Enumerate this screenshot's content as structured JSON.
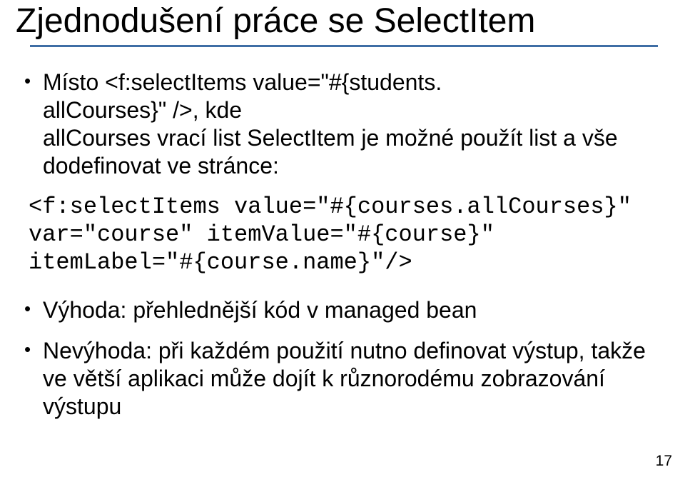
{
  "title": "Zjednodušení práce se SelectItem",
  "bullets": {
    "b1_a": "Místo <f:selectItems value=\"#{students.",
    "b1_b": "allCourses}\" />, kde",
    "b1_c": "allCourses vrací list SelectItem je možné použít list a vše dodefinovat ve stránce:",
    "b2": "Výhoda: přehlednější kód v managed bean",
    "b3": "Nevýhoda: při každém použití nutno definovat výstup, takže ve větší aplikaci může dojít k různorodému zobrazování výstupu"
  },
  "code": "<f:selectItems value=\"#{courses.allCourses}\"\nvar=\"course\" itemValue=\"#{course}\"\nitemLabel=\"#{course.name}\"/>",
  "page_number": "17"
}
